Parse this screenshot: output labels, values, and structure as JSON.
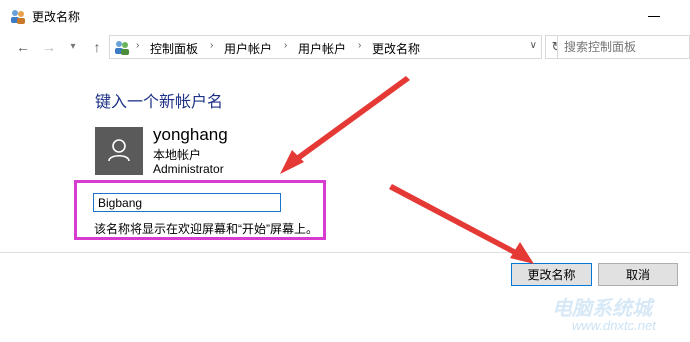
{
  "window": {
    "title": "更改名称",
    "icon": "users-icon"
  },
  "navigation": {
    "back_icon": "arrow-left-icon",
    "forward_icon": "arrow-right-icon",
    "recent_icon": "chevron-down-icon",
    "up_icon": "arrow-up-icon",
    "breadcrumbs": [
      "控制面板",
      "用户帐户",
      "用户帐户",
      "更改名称"
    ],
    "search_placeholder": "搜索控制面板"
  },
  "content": {
    "heading": "键入一个新帐户名",
    "user": {
      "name": "yonghang",
      "type": "本地帐户",
      "role": "Administrator"
    },
    "new_name_value": "Bigbang",
    "hint": "该名称将显示在欢迎屏幕和“开始”屏幕上。"
  },
  "buttons": {
    "change_name": "更改名称",
    "cancel": "取消"
  },
  "colors": {
    "heading": "#1e3287",
    "highlight_border": "#d73bcf",
    "annotation_arrow": "#e53935",
    "primary_button_border": "#0078d7"
  },
  "watermark": {
    "site": "电脑系统城",
    "url": "www.dnxtc.net"
  }
}
